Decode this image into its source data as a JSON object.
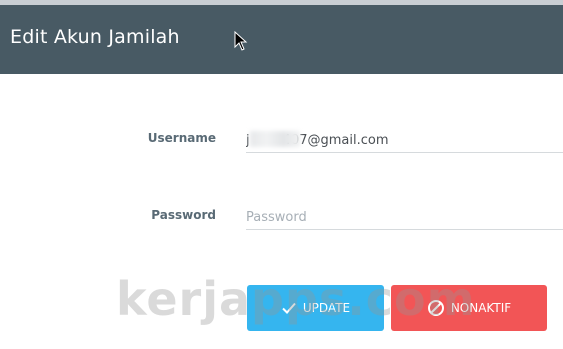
{
  "header": {
    "title": "Edit Akun Jamilah"
  },
  "form": {
    "username_label": "Username",
    "username_value": "j        407@gmail.com",
    "password_label": "Password",
    "password_placeholder": "Password"
  },
  "buttons": {
    "update_label": "UPDATE",
    "update_icon": "check-icon",
    "nonaktif_label": "NONAKTIF",
    "nonaktif_icon": "ban-icon"
  },
  "watermark": {
    "text": "kerjapps.com"
  },
  "colors": {
    "header_bg": "#485a64",
    "update_button": "#35b5ef",
    "nonaktif_button": "#f25556"
  }
}
